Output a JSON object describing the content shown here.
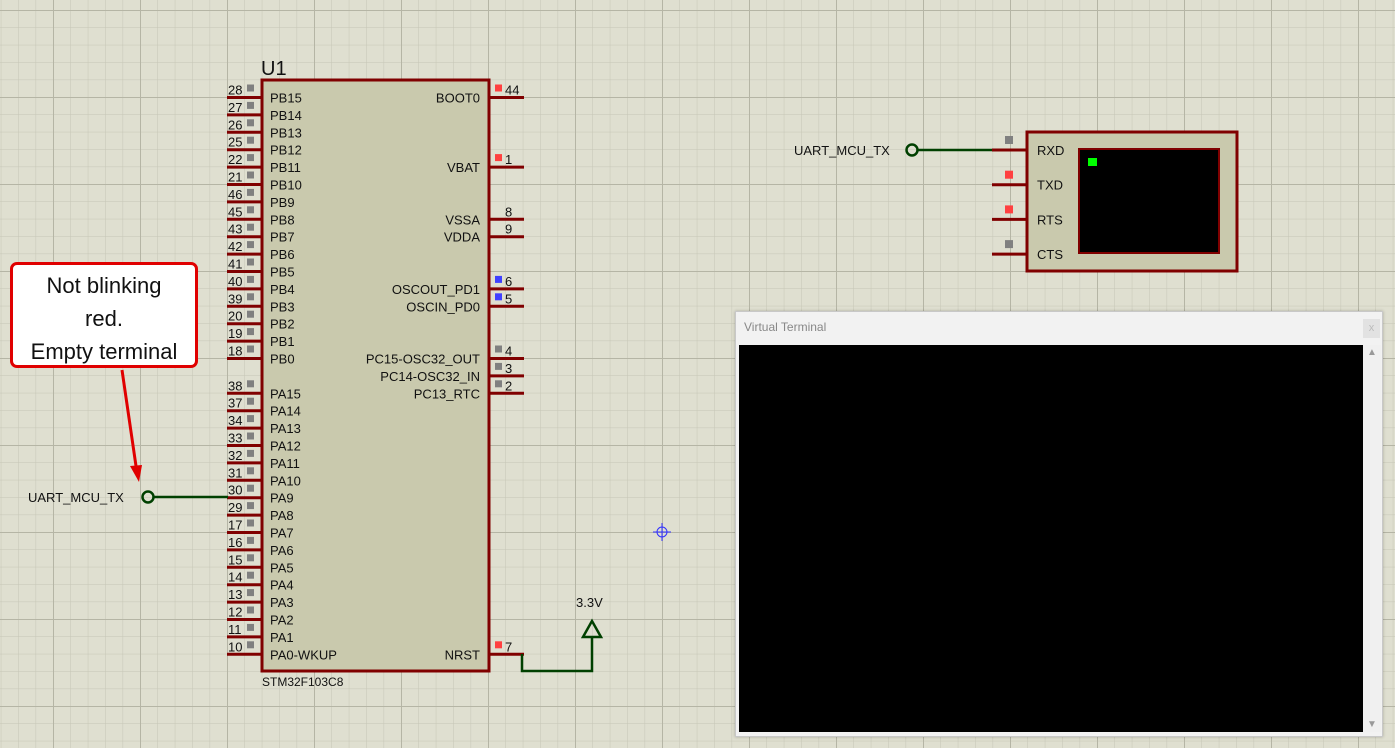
{
  "chip": {
    "ref": "U1",
    "part": "STM32F103C8",
    "left_pins": [
      {
        "name": "PB15",
        "num": "28",
        "state": "gray",
        "row": 0
      },
      {
        "name": "PB14",
        "num": "27",
        "state": "gray",
        "row": 1
      },
      {
        "name": "PB13",
        "num": "26",
        "state": "gray",
        "row": 2
      },
      {
        "name": "PB12",
        "num": "25",
        "state": "gray",
        "row": 3
      },
      {
        "name": "PB11",
        "num": "22",
        "state": "gray",
        "row": 4
      },
      {
        "name": "PB10",
        "num": "21",
        "state": "gray",
        "row": 5
      },
      {
        "name": "PB9",
        "num": "46",
        "state": "gray",
        "row": 6
      },
      {
        "name": "PB8",
        "num": "45",
        "state": "gray",
        "row": 7
      },
      {
        "name": "PB7",
        "num": "43",
        "state": "gray",
        "row": 8
      },
      {
        "name": "PB6",
        "num": "42",
        "state": "gray",
        "row": 9
      },
      {
        "name": "PB5",
        "num": "41",
        "state": "gray",
        "row": 10
      },
      {
        "name": "PB4",
        "num": "40",
        "state": "gray",
        "row": 11
      },
      {
        "name": "PB3",
        "num": "39",
        "state": "gray",
        "row": 12
      },
      {
        "name": "PB2",
        "num": "20",
        "state": "gray",
        "row": 13
      },
      {
        "name": "PB1",
        "num": "19",
        "state": "gray",
        "row": 14
      },
      {
        "name": "PB0",
        "num": "18",
        "state": "gray",
        "row": 15
      },
      {
        "name": "PA15",
        "num": "38",
        "state": "gray",
        "row": 17
      },
      {
        "name": "PA14",
        "num": "37",
        "state": "gray",
        "row": 18
      },
      {
        "name": "PA13",
        "num": "34",
        "state": "gray",
        "row": 19
      },
      {
        "name": "PA12",
        "num": "33",
        "state": "gray",
        "row": 20
      },
      {
        "name": "PA11",
        "num": "32",
        "state": "gray",
        "row": 21
      },
      {
        "name": "PA10",
        "num": "31",
        "state": "gray",
        "row": 22
      },
      {
        "name": "PA9",
        "num": "30",
        "state": "gray",
        "row": 23
      },
      {
        "name": "PA8",
        "num": "29",
        "state": "gray",
        "row": 24
      },
      {
        "name": "PA7",
        "num": "17",
        "state": "gray",
        "row": 25
      },
      {
        "name": "PA6",
        "num": "16",
        "state": "gray",
        "row": 26
      },
      {
        "name": "PA5",
        "num": "15",
        "state": "gray",
        "row": 27
      },
      {
        "name": "PA4",
        "num": "14",
        "state": "gray",
        "row": 28
      },
      {
        "name": "PA3",
        "num": "13",
        "state": "gray",
        "row": 29
      },
      {
        "name": "PA2",
        "num": "12",
        "state": "gray",
        "row": 30
      },
      {
        "name": "PA1",
        "num": "11",
        "state": "gray",
        "row": 31
      },
      {
        "name": "PA0-WKUP",
        "num": "10",
        "state": "gray",
        "row": 32
      }
    ],
    "right_pins": [
      {
        "name": "BOOT0",
        "num": "44",
        "state": "red",
        "row": 0
      },
      {
        "name": "VBAT",
        "num": "1",
        "state": "red",
        "row": 4
      },
      {
        "name": "VSSA",
        "num": "8",
        "state": "none",
        "row": 7
      },
      {
        "name": "VDDA",
        "num": "9",
        "state": "none",
        "row": 8
      },
      {
        "name": "OSCOUT_PD1",
        "num": "6",
        "state": "blue",
        "row": 11
      },
      {
        "name": "OSCIN_PD0",
        "num": "5",
        "state": "blue",
        "row": 12
      },
      {
        "name": "PC15-OSC32_OUT",
        "num": "4",
        "state": "gray",
        "row": 15
      },
      {
        "name": "PC14-OSC32_IN",
        "num": "3",
        "state": "gray",
        "row": 16
      },
      {
        "name": "PC13_RTC",
        "num": "2",
        "state": "gray",
        "row": 17
      },
      {
        "name": "NRST",
        "num": "7",
        "state": "red",
        "row": 32
      }
    ]
  },
  "terminal_part": {
    "pins": [
      {
        "name": "RXD",
        "state": "gray"
      },
      {
        "name": "TXD",
        "state": "red"
      },
      {
        "name": "RTS",
        "state": "red"
      },
      {
        "name": "CTS",
        "state": "gray"
      }
    ]
  },
  "net_labels": {
    "left": "UART_MCU_TX",
    "right": "UART_MCU_TX"
  },
  "power_label": "3.3V",
  "callout": {
    "lines": [
      "Not blinking",
      "red.",
      "Empty terminal"
    ]
  },
  "virtual_terminal": {
    "title": "Virtual Terminal",
    "close_label": "x",
    "scroll_up": "▲",
    "scroll_down": "▼"
  },
  "colors": {
    "background": "#dfdfd0",
    "body": "#c9c9ad",
    "outline": "#800000",
    "wire": "#004000",
    "red": "#ff4040",
    "blue": "#4040ff",
    "gray": "#808080",
    "callout": "#e00000"
  }
}
